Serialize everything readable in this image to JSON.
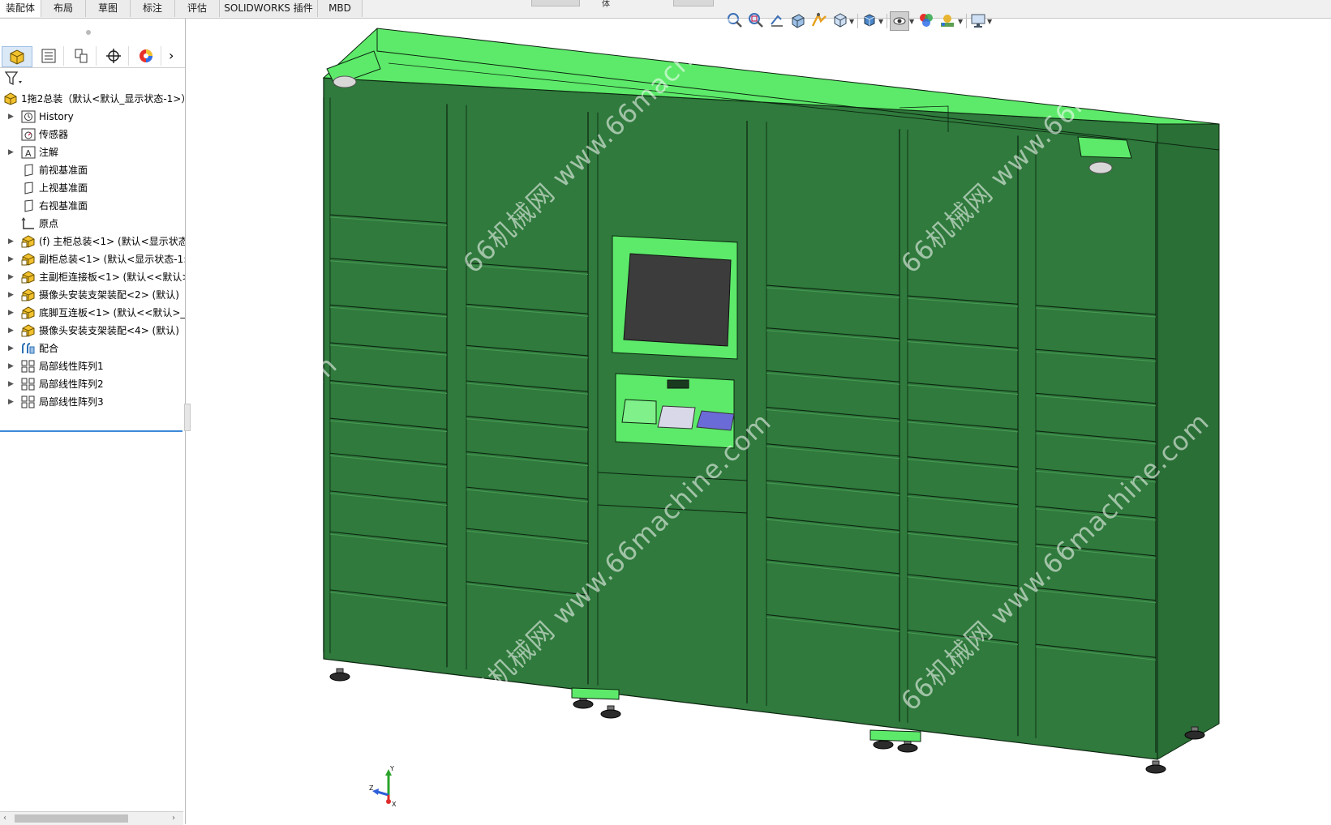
{
  "command_tabs": [
    {
      "label": "装配体",
      "active": true
    },
    {
      "label": "布局",
      "active": false
    },
    {
      "label": "草图",
      "active": false
    },
    {
      "label": "标注",
      "active": false
    },
    {
      "label": "评估",
      "active": false
    },
    {
      "label": "SOLIDWORKS 插件",
      "active": false
    },
    {
      "label": "MBD",
      "active": false
    }
  ],
  "top_stub_label": "体",
  "hud_icons": [
    "zoom-to-fit-icon",
    "zoom-area-icon",
    "previous-view-icon",
    "section-view-icon",
    "dynamic-annotation-icon",
    "view-orientation-icon",
    "display-style-icon",
    "hide-show-icon",
    "edit-appearance-icon",
    "apply-scene-icon",
    "view-settings-icon"
  ],
  "feature_tabs": [
    "featuremanager-tab",
    "propertymanager-tab",
    "configurationmanager-tab",
    "dimxpert-tab",
    "displaymanager-tab"
  ],
  "feature_tree": {
    "root": "1拖2总装（默认<默认_显示状态-1>）",
    "items": [
      {
        "label": "History",
        "expandable": true,
        "icon": "history-icon"
      },
      {
        "label": "传感器",
        "expandable": false,
        "icon": "sensor-icon"
      },
      {
        "label": "注解",
        "expandable": true,
        "icon": "annotation-icon"
      },
      {
        "label": "前视基准面",
        "expandable": false,
        "icon": "plane-icon"
      },
      {
        "label": "上视基准面",
        "expandable": false,
        "icon": "plane-icon"
      },
      {
        "label": "右视基准面",
        "expandable": false,
        "icon": "plane-icon"
      },
      {
        "label": "原点",
        "expandable": false,
        "icon": "origin-icon"
      },
      {
        "label": "(f) 主柜总装<1> (默认<显示状态",
        "expandable": true,
        "icon": "subassembly-icon"
      },
      {
        "label": "副柜总装<1> (默认<显示状态-1:",
        "expandable": true,
        "icon": "subassembly-icon"
      },
      {
        "label": "主副柜连接板<1> (默认<<默认>",
        "expandable": true,
        "icon": "subassembly-icon"
      },
      {
        "label": "摄像头安装支架装配<2> (默认)",
        "expandable": true,
        "icon": "subassembly-icon"
      },
      {
        "label": "底脚互连板<1> (默认<<默认>_显",
        "expandable": true,
        "icon": "subassembly-icon"
      },
      {
        "label": "摄像头安装支架装配<4> (默认)",
        "expandable": true,
        "icon": "subassembly-icon"
      },
      {
        "label": "配合",
        "expandable": true,
        "icon": "mates-icon"
      },
      {
        "label": "局部线性阵列1",
        "expandable": true,
        "icon": "linear-pattern-icon"
      },
      {
        "label": "局部线性阵列2",
        "expandable": true,
        "icon": "linear-pattern-icon"
      },
      {
        "label": "局部线性阵列3",
        "expandable": true,
        "icon": "linear-pattern-icon"
      }
    ]
  },
  "triad": {
    "x": "X",
    "y": "Y",
    "z": "Z"
  },
  "watermarks": [
    "66机械网 www.66machine.com",
    "66机械网 www.66machine.com",
    "66机械网 www.66machine.com",
    "66机械网 www.66machine.com",
    "66机械网 www.66machine.com",
    "66机械网 www.66machine.com"
  ],
  "colors": {
    "cabinet_front": "#2f7a3c",
    "cabinet_top": "#5dea6a",
    "cabinet_side": "#2a6f36",
    "edge": "#0c2410",
    "screen": "#3c3c3c",
    "keypad": "#d8d8e8",
    "card_reader": "#6b6bd8",
    "accent": "#3d8ad8"
  }
}
